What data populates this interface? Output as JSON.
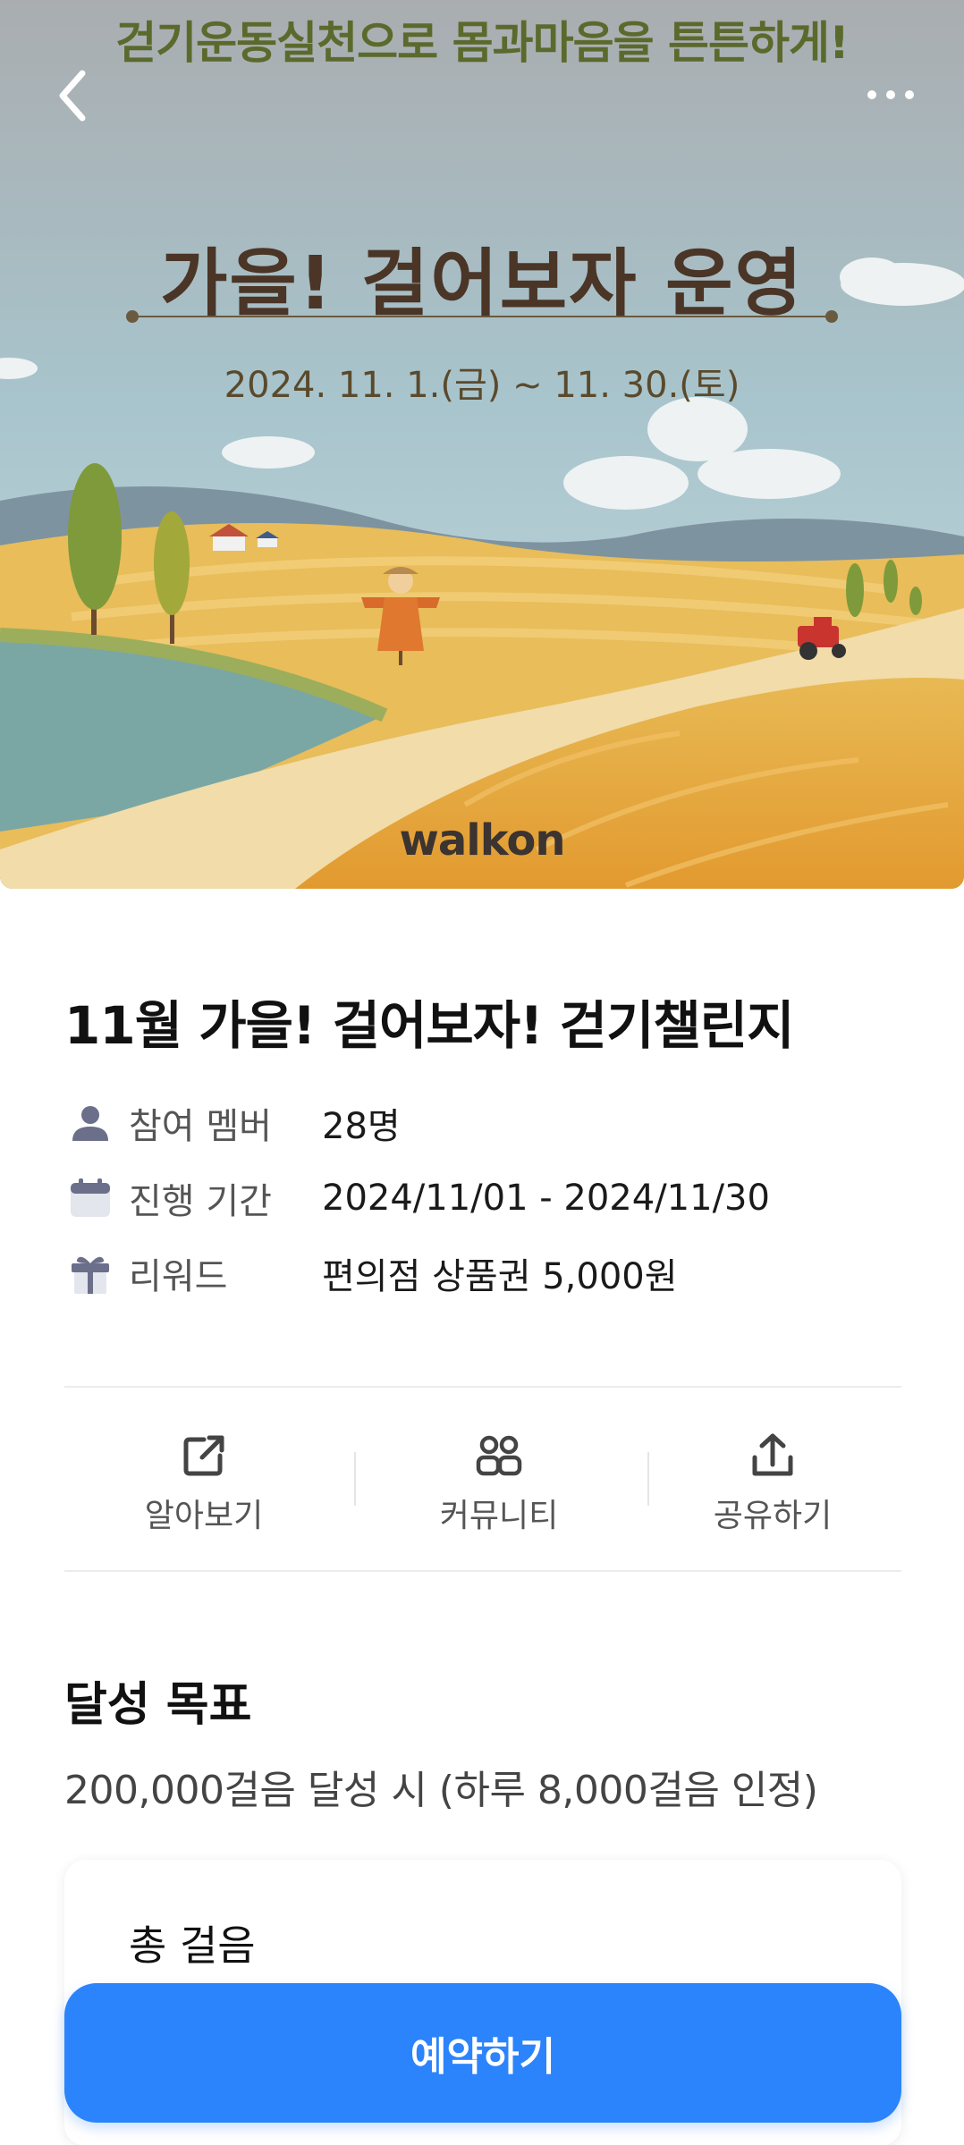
{
  "banner": {
    "slogan": "걷기운동실천으로 몸과마음을 튼튼하게!",
    "title": "가을! 걸어보자 운영",
    "date": "2024. 11. 1.(금) ~ 11. 30.(토)",
    "logo_text": "walkon"
  },
  "header": {
    "back_icon": "chevron-left-icon",
    "more_icon": "more-horizontal-icon"
  },
  "challenge": {
    "title": "11월 가을!  걸어보자! 걷기챌린지",
    "info": [
      {
        "icon": "person-icon",
        "label": "참여 멤버",
        "value": "28명"
      },
      {
        "icon": "calendar-icon",
        "label": "진행 기간",
        "value": "2024/11/01 - 2024/11/30"
      },
      {
        "icon": "gift-icon",
        "label": "리워드",
        "value": "편의점 상품권 5,000원"
      }
    ]
  },
  "actions": [
    {
      "icon": "external-link-icon",
      "label": "알아보기"
    },
    {
      "icon": "community-icon",
      "label": "커뮤니티"
    },
    {
      "icon": "share-icon",
      "label": "공유하기"
    }
  ],
  "goal": {
    "title": "달성 목표",
    "description": "200,000걸음 달성 시  (하루 8,000걸음 인정)"
  },
  "steps_card": {
    "label": "총 걸음"
  },
  "cta": {
    "label": "예약하기"
  },
  "colors": {
    "accent": "#2b84fb",
    "icon_gray": "#6b6f8a"
  }
}
